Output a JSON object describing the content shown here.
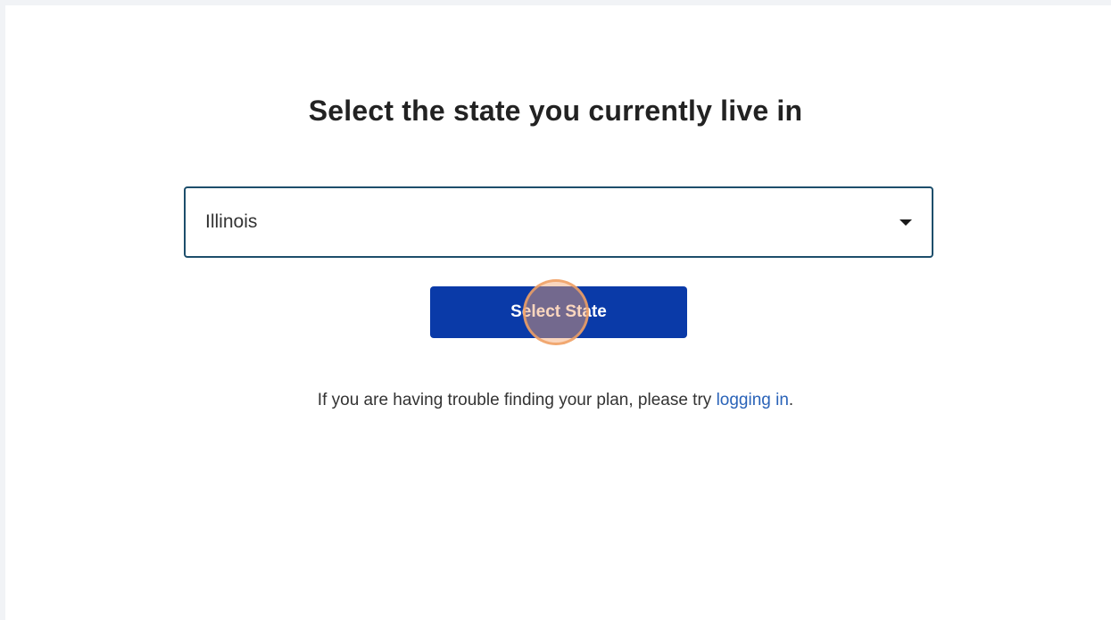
{
  "page": {
    "title": "Select the state you currently live in"
  },
  "state_select": {
    "selected_value": "Illinois",
    "caret_icon": "caret-down-icon"
  },
  "submit": {
    "label": "Select State",
    "color": "#0a3aa8"
  },
  "help": {
    "text_before": "If you are having trouble finding your plan, please try ",
    "link_label": "logging in",
    "text_after": ".",
    "link_color": "#2a63b8"
  }
}
